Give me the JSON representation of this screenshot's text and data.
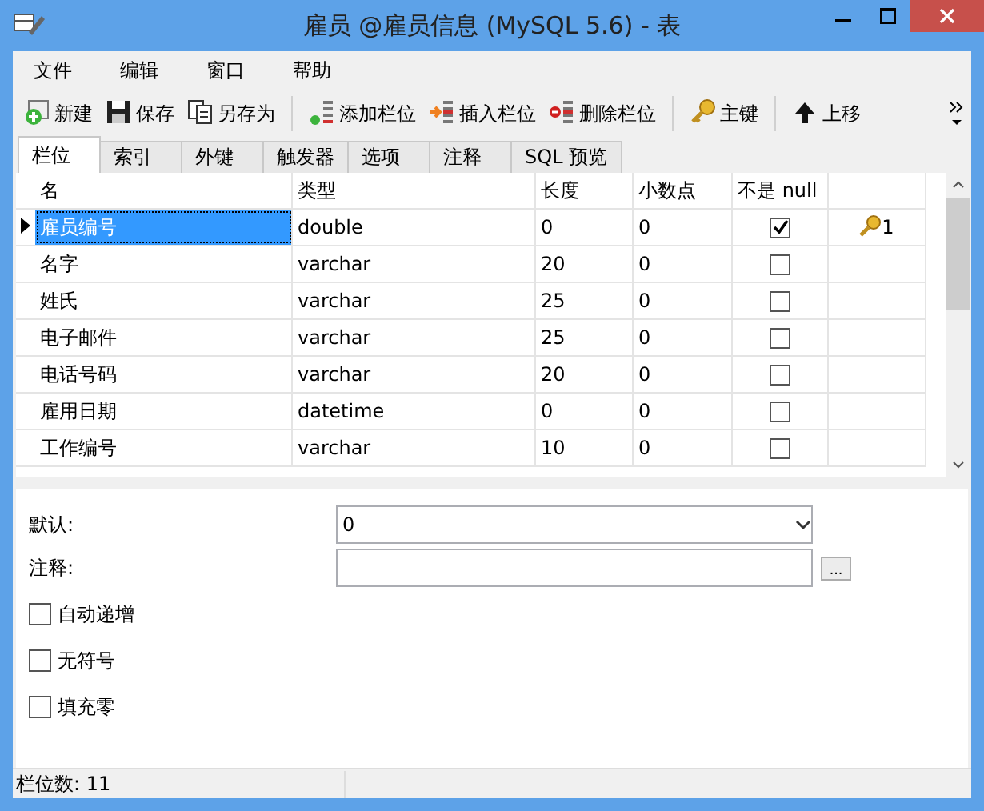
{
  "window": {
    "title": "雇员 @雇员信息 (MySQL 5.6) - 表"
  },
  "menu": [
    "文件",
    "编辑",
    "窗口",
    "帮助"
  ],
  "toolbar": [
    {
      "kind": "new",
      "label": "新建"
    },
    {
      "kind": "save",
      "label": "保存"
    },
    {
      "kind": "saveas",
      "label": "另存为"
    },
    {
      "kind": "sep"
    },
    {
      "kind": "add",
      "label": "添加栏位"
    },
    {
      "kind": "insert",
      "label": "插入栏位"
    },
    {
      "kind": "delete",
      "label": "删除栏位"
    },
    {
      "kind": "sep"
    },
    {
      "kind": "key",
      "label": "主键"
    },
    {
      "kind": "sep"
    },
    {
      "kind": "up",
      "label": "上移"
    }
  ],
  "tabs": [
    {
      "label": "栏位",
      "selected": true
    },
    {
      "label": "索引",
      "selected": false
    },
    {
      "label": "外键",
      "selected": false
    },
    {
      "label": "触发器",
      "selected": false
    },
    {
      "label": "选项",
      "selected": false
    },
    {
      "label": "注释",
      "selected": false
    },
    {
      "label": "SQL 预览",
      "selected": false
    }
  ],
  "table": {
    "columns": [
      "名",
      "类型",
      "长度",
      "小数点",
      "不是 null"
    ],
    "rows": [
      {
        "name": "雇员编号",
        "type": "double",
        "length": "0",
        "decimals": "0",
        "not_null": true,
        "key": "1",
        "selected": true
      },
      {
        "name": "名字",
        "type": "varchar",
        "length": "20",
        "decimals": "0",
        "not_null": false,
        "selected": false
      },
      {
        "name": "姓氏",
        "type": "varchar",
        "length": "25",
        "decimals": "0",
        "not_null": false,
        "selected": false
      },
      {
        "name": "电子邮件",
        "type": "varchar",
        "length": "25",
        "decimals": "0",
        "not_null": false,
        "selected": false
      },
      {
        "name": "电话号码",
        "type": "varchar",
        "length": "20",
        "decimals": "0",
        "not_null": false,
        "selected": false
      },
      {
        "name": "雇用日期",
        "type": "datetime",
        "length": "0",
        "decimals": "0",
        "not_null": false,
        "selected": false
      },
      {
        "name": "工作编号",
        "type": "varchar",
        "length": "10",
        "decimals": "0",
        "not_null": false,
        "selected": false
      }
    ]
  },
  "properties": {
    "default_label": "默认:",
    "default_value": "0",
    "comment_label": "注释:",
    "more_button": "...",
    "options": [
      {
        "label": "自动递增",
        "checked": false
      },
      {
        "label": "无符号",
        "checked": false
      },
      {
        "label": "填充零",
        "checked": false
      }
    ]
  },
  "status_bar": "栏位数: 11"
}
